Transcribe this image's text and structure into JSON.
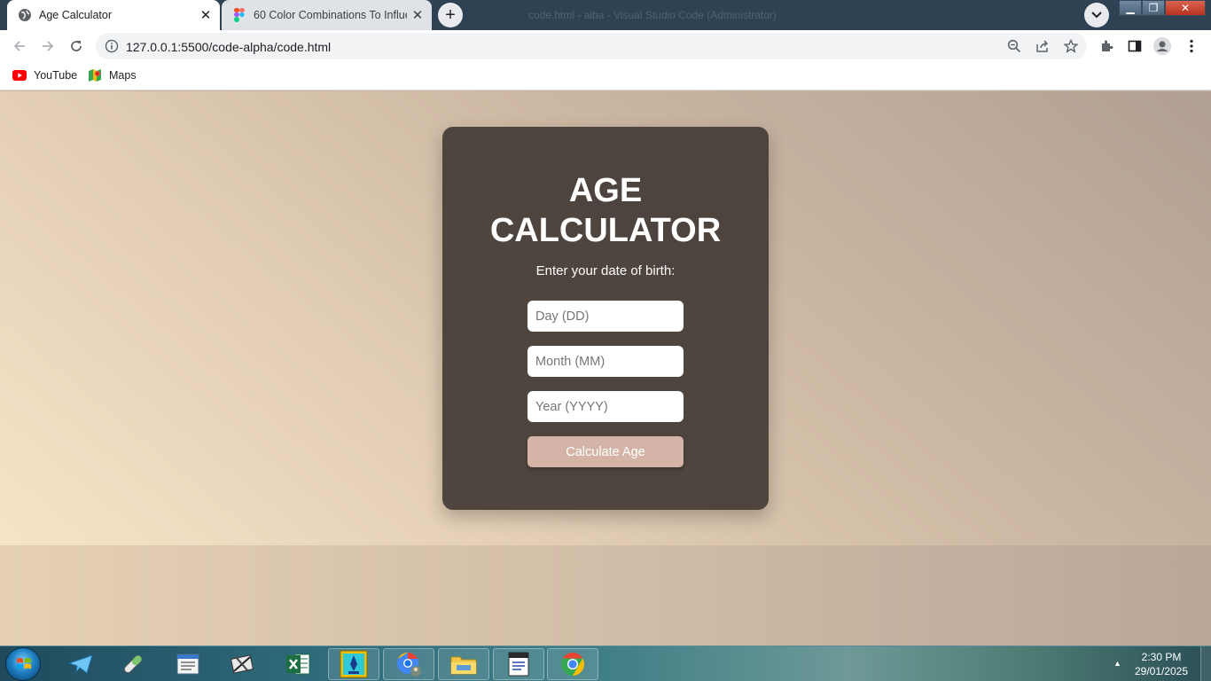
{
  "browser": {
    "tabs": [
      {
        "title": "Age Calculator",
        "active": true
      },
      {
        "title": "60 Color Combinations To Influence",
        "active": false
      }
    ],
    "window_title": "code.html - alba - Visual Studio Code (Administrator)",
    "url": "127.0.0.1:5500/code-alpha/code.html",
    "bookmarks": [
      {
        "label": "YouTube",
        "icon": "youtube-icon"
      },
      {
        "label": "Maps",
        "icon": "maps-icon"
      }
    ]
  },
  "page": {
    "title_line1": "AGE",
    "title_line2": "CALCULATOR",
    "prompt": "Enter your date of birth:",
    "inputs": {
      "day_placeholder": "Day (DD)",
      "month_placeholder": "Month (MM)",
      "year_placeholder": "Year (YYYY)"
    },
    "button_label": "Calculate Age",
    "colors": {
      "card": "#49403a",
      "button": "#d4b4a7",
      "text": "#ffffff"
    }
  },
  "taskbar": {
    "apps": [
      "start-orb",
      "telegram-icon",
      "pill-icon",
      "notepad-icon",
      "tools-icon",
      "excel-icon",
      "pen-tool-icon",
      "chrome-profile-icon",
      "file-explorer-icon",
      "text-editor-icon",
      "chrome-icon"
    ],
    "time": "2:30 PM",
    "date": "29/01/2025"
  }
}
